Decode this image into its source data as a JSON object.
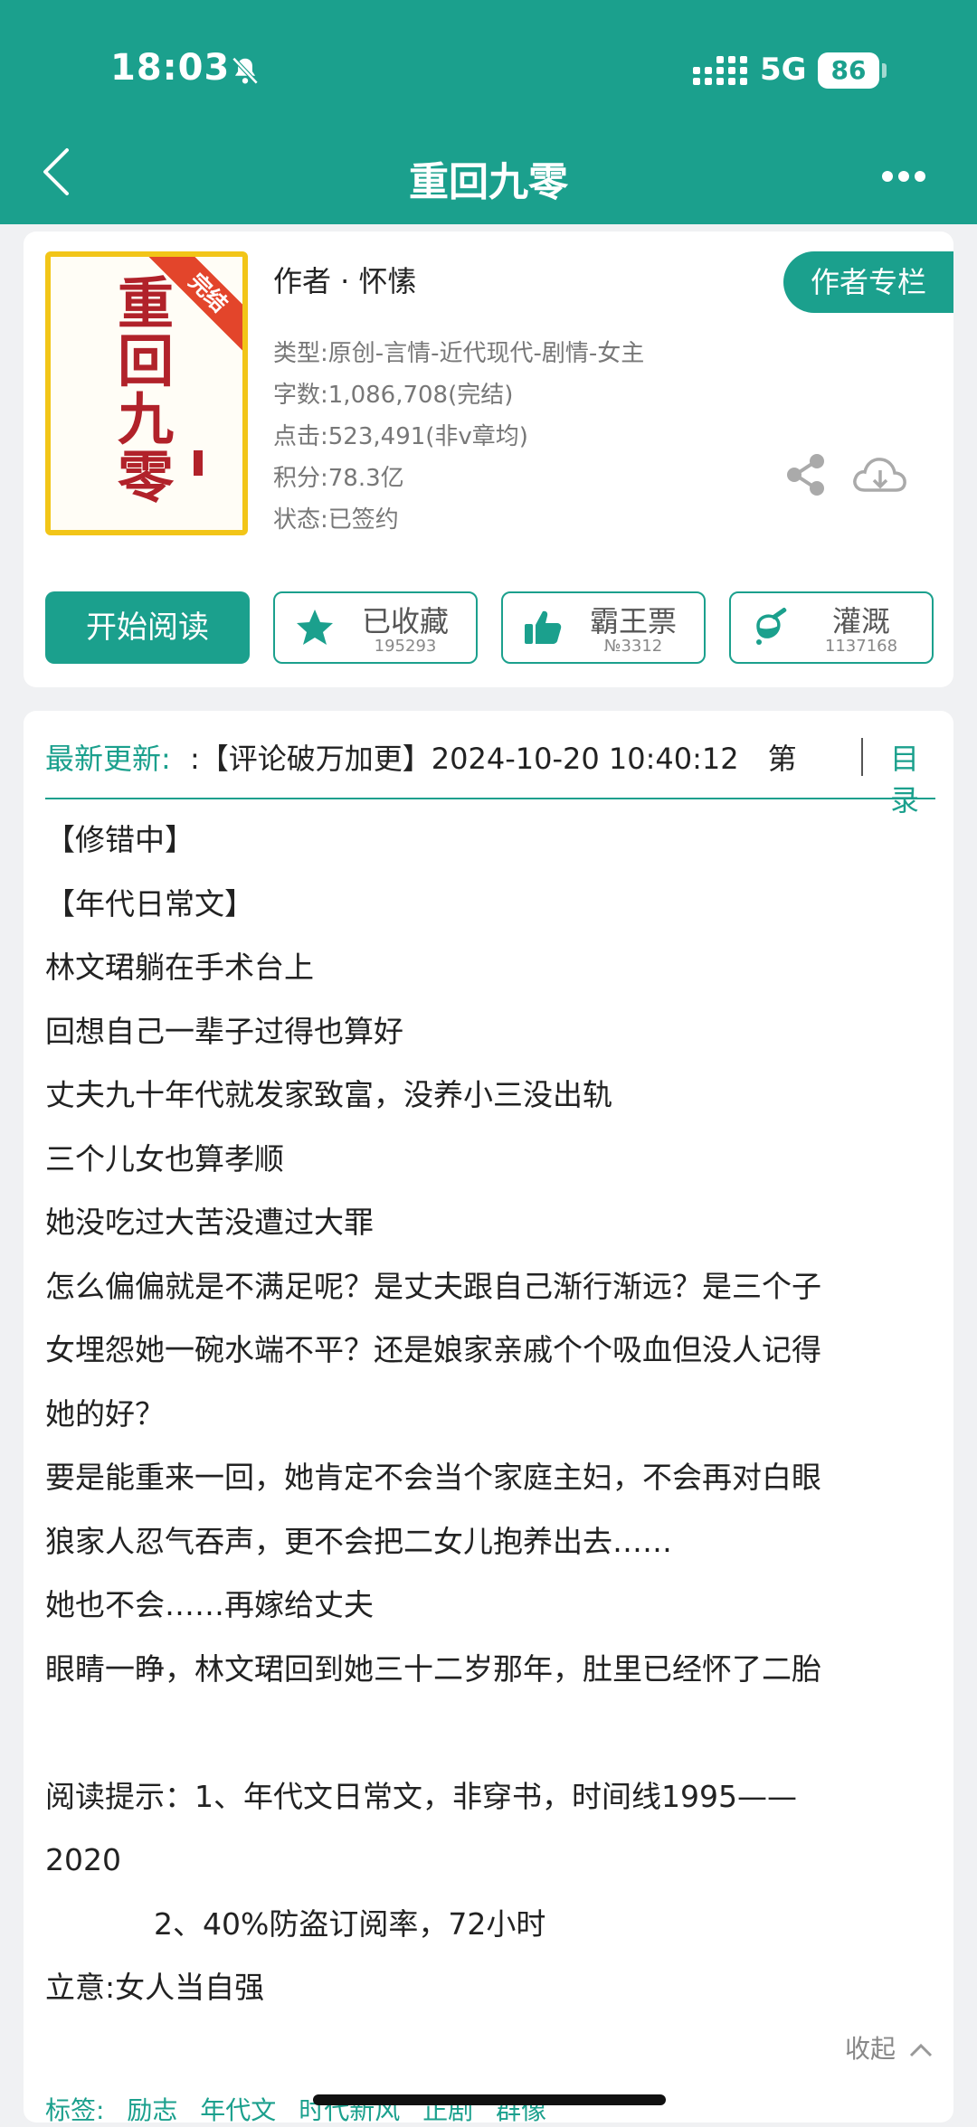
{
  "status_bar": {
    "time": "18:03",
    "network": "5G",
    "battery": "86"
  },
  "header": {
    "title": "重回九零"
  },
  "book": {
    "cover_title_chars": [
      "重",
      "回",
      "九",
      "零"
    ],
    "cover_badge": "完结",
    "author": "作者 · 怀愫",
    "author_page_button": "作者专栏",
    "meta": [
      "类型:原创-言情-近代现代-剧情-女主",
      "字数:1,086,708(完结)",
      "点击:523,491(非v章均)",
      "积分:78.3亿",
      "状态:已签约"
    ]
  },
  "actions": {
    "start_reading": "开始阅读",
    "favorite": {
      "label": "已收藏",
      "count": "195293"
    },
    "vote": {
      "label": "霸王票",
      "count": "№3312"
    },
    "nutrient": {
      "label": "灌溉",
      "count": "1137168"
    }
  },
  "update": {
    "label": "最新更新:",
    "text": ":【评论破万加更】2024-10-20 10:40:12　第",
    "toc": "目录"
  },
  "description": [
    "【修错中】",
    "【年代日常文】",
    "林文珺躺在手术台上",
    "回想自己一辈子过得也算好",
    "丈夫九十年代就发家致富，没养小三没出轨",
    "三个儿女也算孝顺",
    "她没吃过大苦没遭过大罪",
    "怎么偏偏就是不满足呢？是丈夫跟自己渐行渐远？是三个子",
    "女埋怨她一碗水端不平？还是娘家亲戚个个吸血但没人记得",
    "她的好？",
    "要是能重来一回，她肯定不会当个家庭主妇，不会再对白眼",
    "狼家人忍气吞声，更不会把二女儿抱养出去……",
    "她也不会……再嫁给丈夫",
    "眼睛一睁，林文珺回到她三十二岁那年，肚里已经怀了二胎",
    "",
    "阅读提示：1、年代文日常文，非穿书，时间线1995——",
    "2020",
    "2、40%防盗订阅率，72小时",
    "立意:女人当自强"
  ],
  "collapse": "收起",
  "tags": {
    "label": "标签:",
    "items": [
      "励志",
      "年代文",
      "时代新风",
      "正剧",
      "群像"
    ]
  },
  "colors": {
    "brand": "#1ba08d",
    "ribbon": "#e3452b",
    "cover_frame": "#f2c518",
    "cover_text": "#b1222a"
  }
}
